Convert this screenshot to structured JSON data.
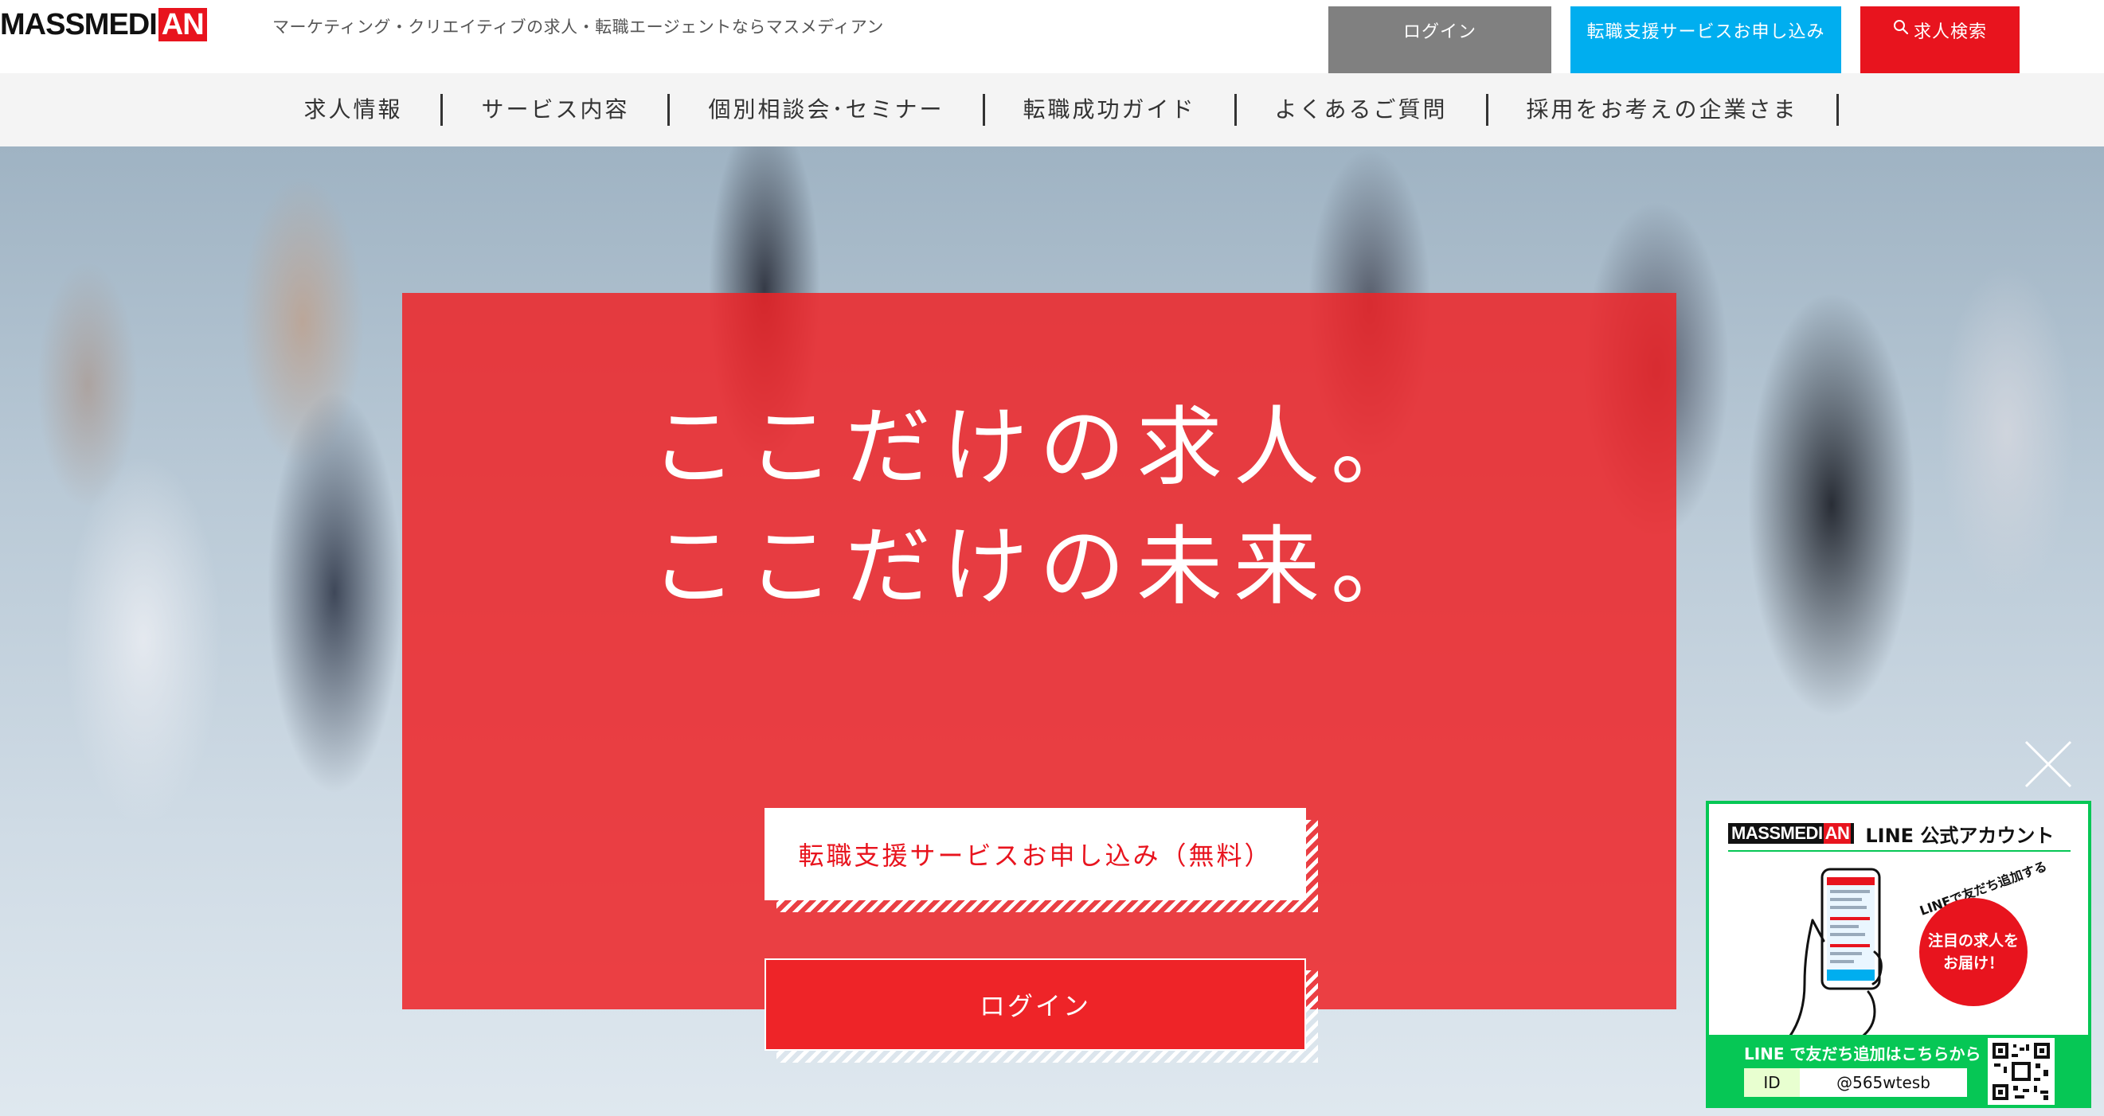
{
  "header": {
    "logo_main": "MASSMEDI",
    "logo_accent": "AN",
    "tagline": "マーケティング・クリエイティブの求人・転職エージェントならマスメディアン",
    "login_label": "ログイン",
    "apply_label": "転職支援サービスお申し込み",
    "search_label": "求人検索"
  },
  "nav": {
    "items": [
      {
        "label": "求人情報"
      },
      {
        "label": "サービス内容"
      },
      {
        "label": "個別相談会･セミナー"
      },
      {
        "label": "転職成功ガイド"
      },
      {
        "label": "よくあるご質問"
      },
      {
        "label": "採用をお考えの企業さま"
      }
    ]
  },
  "hero": {
    "title_line1": "ここだけの求人。",
    "title_line2": "ここだけの未来。",
    "apply_label": "転職支援サービスお申し込み（無料）",
    "login_label": "ログイン"
  },
  "line_widget": {
    "logo_main": "MASSMEDI",
    "logo_accent": "AN",
    "title": "LINE 公式アカウント",
    "curved_text": "LINEで友だち追加すると",
    "badge_line1": "注目の求人を",
    "badge_line2": "お届け！",
    "cta_text": "LINE で友だち追加はこちらから",
    "id_label": "ID",
    "id_value": "@565wtesb"
  },
  "colors": {
    "brand_red": "#e8141e",
    "apply_blue": "#00aeef",
    "login_gray": "#808080",
    "line_green": "#06c755"
  }
}
